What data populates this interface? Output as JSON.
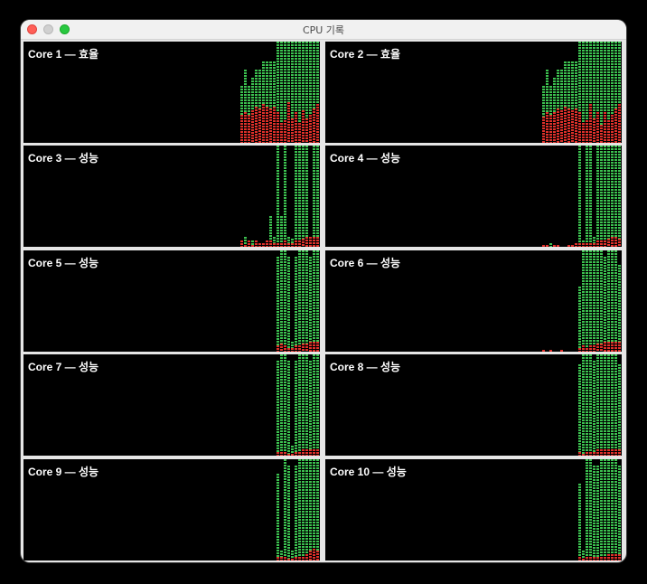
{
  "window": {
    "title": "CPU 기록"
  },
  "colors": {
    "user": "#3cc250",
    "system": "#e0302a"
  },
  "legend_note": "",
  "cores": [
    {
      "label": "Core 1 — 효율",
      "user": [
        0.56,
        0.72,
        0.56,
        0.64,
        0.72,
        0.72,
        0.8,
        0.8,
        0.8,
        0.8,
        1.0,
        1.0,
        1.0,
        1.0,
        1.0,
        1.0,
        1.0,
        1.0,
        1.0,
        1.0,
        1.0,
        1.0
      ],
      "system": [
        0.28,
        0.3,
        0.28,
        0.32,
        0.36,
        0.34,
        0.38,
        0.36,
        0.34,
        0.36,
        0.3,
        0.2,
        0.22,
        0.4,
        0.24,
        0.3,
        0.2,
        0.32,
        0.24,
        0.28,
        0.34,
        0.38
      ]
    },
    {
      "label": "Core 2 — 효율",
      "user": [
        0.56,
        0.72,
        0.56,
        0.64,
        0.72,
        0.72,
        0.8,
        0.8,
        0.8,
        0.8,
        1.0,
        1.0,
        1.0,
        1.0,
        1.0,
        1.0,
        1.0,
        1.0,
        1.0,
        1.0,
        1.0,
        1.0
      ],
      "system": [
        0.26,
        0.3,
        0.28,
        0.3,
        0.34,
        0.32,
        0.36,
        0.34,
        0.32,
        0.34,
        0.3,
        0.2,
        0.22,
        0.38,
        0.24,
        0.3,
        0.18,
        0.3,
        0.22,
        0.28,
        0.34,
        0.38
      ]
    },
    {
      "label": "Core 3 — 성능",
      "user": [
        0.04,
        0.1,
        0.02,
        0.06,
        0.04,
        0.02,
        0.04,
        0.04,
        0.3,
        0.1,
        1.0,
        0.3,
        1.0,
        0.1,
        0.08,
        1.0,
        1.0,
        1.0,
        1.0,
        0.1,
        1.0,
        1.0
      ],
      "system": [
        0.06,
        0.02,
        0.06,
        0.02,
        0.06,
        0.04,
        0.04,
        0.06,
        0.06,
        0.04,
        0.04,
        0.04,
        0.06,
        0.04,
        0.04,
        0.06,
        0.06,
        0.08,
        0.1,
        0.1,
        0.1,
        0.1
      ]
    },
    {
      "label": "Core 4 — 성능",
      "user": [
        0.02,
        0.0,
        0.04,
        0.02,
        0.02,
        0.0,
        0.0,
        0.0,
        0.02,
        0.04,
        1.0,
        0.06,
        1.0,
        1.0,
        0.1,
        1.0,
        1.0,
        1.0,
        1.0,
        1.0,
        1.0,
        1.0
      ],
      "system": [
        0.02,
        0.02,
        0.0,
        0.02,
        0.02,
        0.0,
        0.0,
        0.02,
        0.02,
        0.04,
        0.04,
        0.04,
        0.04,
        0.04,
        0.04,
        0.06,
        0.06,
        0.06,
        0.08,
        0.1,
        0.1,
        0.08
      ]
    },
    {
      "label": "Core 5 — 성능",
      "user": [
        0.0,
        0.0,
        0.0,
        0.0,
        0.0,
        0.0,
        0.0,
        0.0,
        0.0,
        0.0,
        0.94,
        1.0,
        1.0,
        0.94,
        0.1,
        0.94,
        1.0,
        1.0,
        1.0,
        0.94,
        1.0,
        1.0
      ],
      "system": [
        0.0,
        0.0,
        0.0,
        0.0,
        0.0,
        0.0,
        0.0,
        0.0,
        0.0,
        0.0,
        0.06,
        0.08,
        0.06,
        0.04,
        0.04,
        0.06,
        0.06,
        0.08,
        0.08,
        0.1,
        0.1,
        0.1
      ]
    },
    {
      "label": "Core 6 — 성능",
      "user": [
        0.0,
        0.0,
        0.0,
        0.0,
        0.0,
        0.0,
        0.0,
        0.0,
        0.0,
        0.0,
        0.64,
        1.0,
        1.0,
        1.0,
        1.0,
        1.0,
        1.0,
        0.94,
        1.0,
        1.0,
        1.0,
        0.86
      ],
      "system": [
        0.02,
        0.0,
        0.02,
        0.0,
        0.0,
        0.02,
        0.0,
        0.0,
        0.0,
        0.0,
        0.04,
        0.06,
        0.04,
        0.06,
        0.06,
        0.08,
        0.08,
        0.1,
        0.1,
        0.1,
        0.1,
        0.1
      ]
    },
    {
      "label": "Core 7 — 성능",
      "user": [
        0.0,
        0.0,
        0.0,
        0.0,
        0.0,
        0.0,
        0.0,
        0.0,
        0.0,
        0.0,
        0.94,
        1.0,
        1.0,
        0.94,
        0.1,
        0.94,
        1.0,
        1.0,
        1.0,
        0.94,
        1.0,
        1.0
      ],
      "system": [
        0.0,
        0.0,
        0.0,
        0.0,
        0.0,
        0.0,
        0.0,
        0.0,
        0.0,
        0.0,
        0.04,
        0.04,
        0.04,
        0.02,
        0.02,
        0.04,
        0.04,
        0.06,
        0.06,
        0.06,
        0.06,
        0.06
      ]
    },
    {
      "label": "Core 8 — 성능",
      "user": [
        0.0,
        0.0,
        0.0,
        0.0,
        0.0,
        0.0,
        0.0,
        0.0,
        0.0,
        0.0,
        0.9,
        1.0,
        1.0,
        1.0,
        0.94,
        1.0,
        1.0,
        1.0,
        1.0,
        1.0,
        1.0,
        0.9
      ],
      "system": [
        0.0,
        0.0,
        0.0,
        0.0,
        0.0,
        0.0,
        0.0,
        0.0,
        0.0,
        0.0,
        0.04,
        0.02,
        0.04,
        0.04,
        0.04,
        0.06,
        0.06,
        0.06,
        0.06,
        0.06,
        0.06,
        0.06
      ]
    },
    {
      "label": "Core 9 — 성능",
      "user": [
        0.0,
        0.0,
        0.0,
        0.0,
        0.0,
        0.0,
        0.0,
        0.0,
        0.0,
        0.0,
        0.86,
        0.1,
        1.0,
        0.94,
        0.1,
        0.94,
        1.0,
        1.0,
        1.0,
        1.0,
        1.0,
        1.0
      ],
      "system": [
        0.0,
        0.0,
        0.0,
        0.0,
        0.0,
        0.0,
        0.0,
        0.0,
        0.0,
        0.0,
        0.04,
        0.04,
        0.04,
        0.02,
        0.02,
        0.04,
        0.04,
        0.04,
        0.06,
        0.1,
        0.12,
        0.1
      ]
    },
    {
      "label": "Core 10 — 성능",
      "user": [
        0.0,
        0.0,
        0.0,
        0.0,
        0.0,
        0.0,
        0.0,
        0.0,
        0.0,
        0.0,
        0.76,
        0.1,
        1.0,
        1.0,
        0.94,
        0.94,
        1.0,
        1.0,
        1.0,
        1.0,
        1.0,
        0.94
      ],
      "system": [
        0.0,
        0.0,
        0.0,
        0.0,
        0.0,
        0.0,
        0.0,
        0.0,
        0.0,
        0.0,
        0.04,
        0.02,
        0.04,
        0.04,
        0.04,
        0.04,
        0.04,
        0.04,
        0.06,
        0.06,
        0.06,
        0.06
      ]
    }
  ]
}
